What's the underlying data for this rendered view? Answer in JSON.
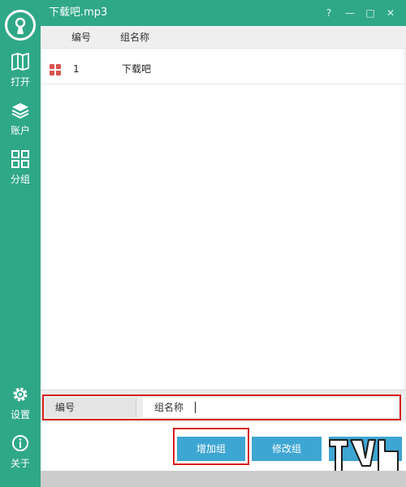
{
  "window": {
    "title": "下载吧.mp3",
    "help_glyph": "?",
    "minimize_glyph": "—",
    "maximize_glyph": "□",
    "close_glyph": "✕"
  },
  "sidebar": {
    "items": [
      {
        "id": "open",
        "label": "打开",
        "icon": "book-open-icon"
      },
      {
        "id": "account",
        "label": "账户",
        "icon": "layers-icon"
      },
      {
        "id": "group",
        "label": "分组",
        "icon": "grid-icon"
      },
      {
        "id": "settings",
        "label": "设置",
        "icon": "gear-icon"
      },
      {
        "id": "about",
        "label": "关于",
        "icon": "info-icon"
      }
    ]
  },
  "table": {
    "columns": [
      "编号",
      "组名称"
    ],
    "rows": [
      {
        "no": "1",
        "name": "下载吧"
      }
    ]
  },
  "editor": {
    "no_label": "编号",
    "name_label": "组名称",
    "name_value": ""
  },
  "buttons": {
    "add": "增加组",
    "modify": "修改组"
  },
  "colors": {
    "accent": "#2fa887",
    "button": "#3ea6d2",
    "highlight": "#d61f1f",
    "row_icon": "#d9534f"
  }
}
